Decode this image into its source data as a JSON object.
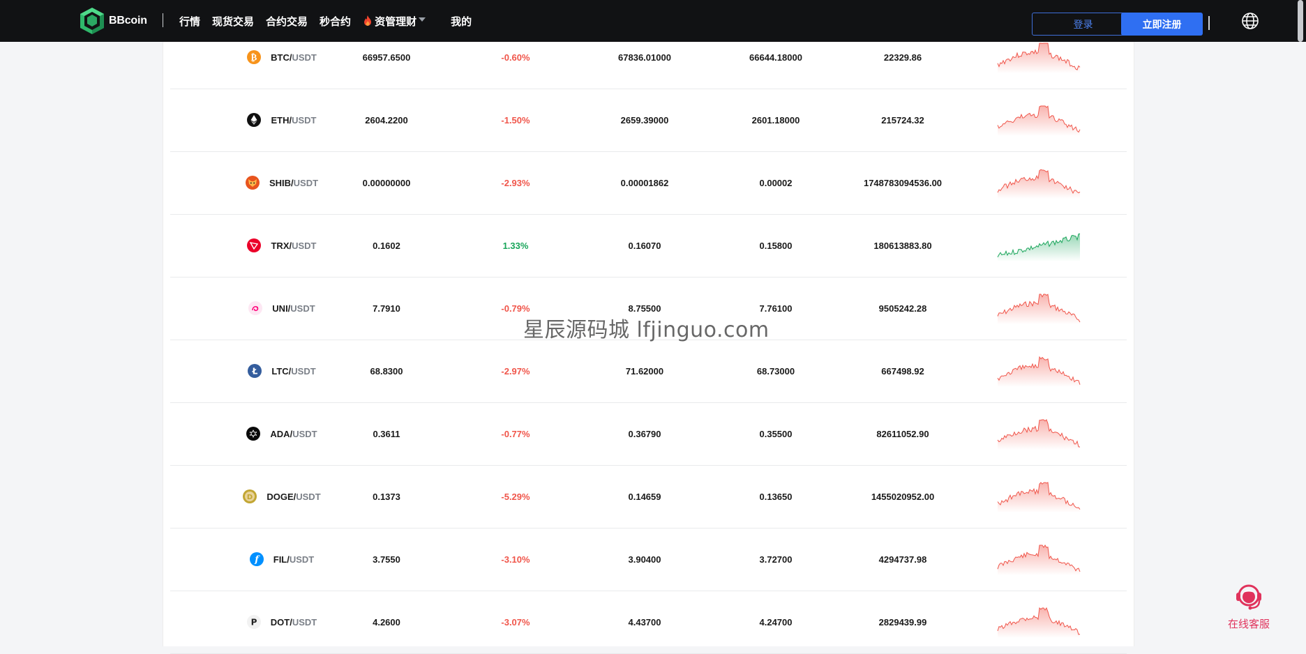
{
  "header": {
    "brand": "BBcoin",
    "nav": [
      "行情",
      "现货交易",
      "合约交易",
      "秒合约",
      "资管理财",
      "我的"
    ],
    "login": "登录",
    "register": "立即注册"
  },
  "rows": [
    {
      "base": "BTC/",
      "quote": " USDT",
      "icon": "btc-icon",
      "price": "66957.6500",
      "change": "-0.60%",
      "trend": "down",
      "high": "67836.01000",
      "low": "66644.18000",
      "volume": "22329.86"
    },
    {
      "base": "ETH/",
      "quote": " USDT",
      "icon": "eth-icon",
      "price": "2604.2200",
      "change": "-1.50%",
      "trend": "down",
      "high": "2659.39000",
      "low": "2601.18000",
      "volume": "215724.32"
    },
    {
      "base": "SHIB/",
      "quote": " USDT",
      "icon": "shib-icon",
      "price": "0.00000000",
      "change": "-2.93%",
      "trend": "down",
      "high": "0.00001862",
      "low": "0.00002",
      "volume": "1748783094536.00"
    },
    {
      "base": "TRX/",
      "quote": " USDT",
      "icon": "trx-icon",
      "price": "0.1602",
      "change": "1.33%",
      "trend": "up",
      "high": "0.16070",
      "low": "0.15800",
      "volume": "180613883.80"
    },
    {
      "base": "UNI/",
      "quote": " USDT",
      "icon": "uni-icon",
      "price": "7.7910",
      "change": "-0.79%",
      "trend": "down",
      "high": "8.75500",
      "low": "7.76100",
      "volume": "9505242.28"
    },
    {
      "base": "LTC/",
      "quote": " USDT",
      "icon": "ltc-icon",
      "price": "68.8300",
      "change": "-2.97%",
      "trend": "down",
      "high": "71.62000",
      "low": "68.73000",
      "volume": "667498.92"
    },
    {
      "base": "ADA/",
      "quote": " USDT",
      "icon": "ada-icon",
      "price": "0.3611",
      "change": "-0.77%",
      "trend": "down",
      "high": "0.36790",
      "low": "0.35500",
      "volume": "82611052.90"
    },
    {
      "base": "DOGE/",
      "quote": " USDT",
      "icon": "doge-icon",
      "price": "0.1373",
      "change": "-5.29%",
      "trend": "down",
      "high": "0.14659",
      "low": "0.13650",
      "volume": "1455020952.00"
    },
    {
      "base": "FIL/",
      "quote": " USDT",
      "icon": "fil-icon",
      "price": "3.7550",
      "change": "-3.10%",
      "trend": "down",
      "high": "3.90400",
      "low": "3.72700",
      "volume": "4294737.98"
    },
    {
      "base": "DOT/",
      "quote": " USDT",
      "icon": "dot-icon",
      "price": "4.2600",
      "change": "-3.07%",
      "trend": "down",
      "high": "4.43700",
      "low": "4.24700",
      "volume": "2829439.99"
    }
  ],
  "colors": {
    "down": "#f0554a",
    "up": "#19a55a",
    "register": "#2f6ff2",
    "navbar": "#111214"
  },
  "watermark": "星辰源码城 lfjinguo.com",
  "service_label": "在线客服"
}
